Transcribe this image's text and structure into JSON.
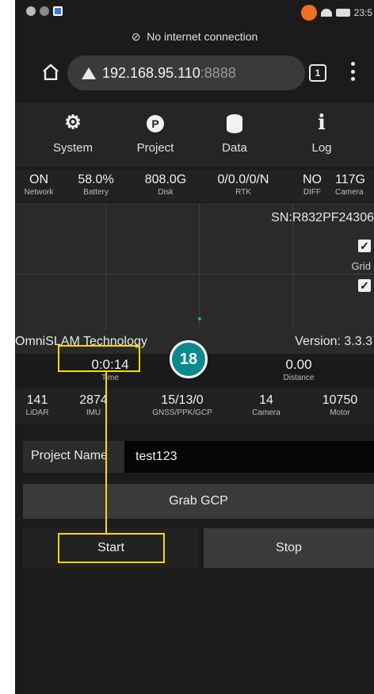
{
  "status_bar": {
    "time": "23:5"
  },
  "connection_banner": "No internet connection",
  "url_bar": {
    "host": "192.168.95.110",
    "port": ":8888",
    "tab_count": "1"
  },
  "nav": [
    {
      "label": "System",
      "icon": "gears-icon"
    },
    {
      "label": "Project",
      "icon": "project-icon",
      "glyph": "P"
    },
    {
      "label": "Data",
      "icon": "database-icon"
    },
    {
      "label": "Log",
      "icon": "info-icon",
      "glyph": "i"
    }
  ],
  "metrics_top": [
    {
      "value": "ON",
      "key": "Network"
    },
    {
      "value": "58.0%",
      "key": "Battery"
    },
    {
      "value": "808.0G",
      "key": "Disk"
    },
    {
      "value": "0/0.0/0/N",
      "key": "RTK"
    },
    {
      "value": "NO",
      "key": "DIFF"
    },
    {
      "value": "117G",
      "key": "Camera"
    }
  ],
  "map": {
    "serial": "SN:R832PF24306",
    "grid_label": "Grid"
  },
  "device": {
    "brand": "OmniSLAM Technology",
    "version": "Version: 3.3.3"
  },
  "progress": {
    "time_value": "0:0:14",
    "time_key": "Time",
    "distance_value": "0.00",
    "distance_key": "Distance"
  },
  "metrics_bottom": [
    {
      "value": "141",
      "key": "LiDAR"
    },
    {
      "value": "2874",
      "key": "IMU"
    },
    {
      "value": "15/13/0",
      "key": "GNSS/PPK/GCP"
    },
    {
      "value": "14",
      "key": "Camera"
    },
    {
      "value": "10750",
      "key": "Motor"
    }
  ],
  "form": {
    "project_name_label": "Project Name",
    "project_name_value": "test123",
    "grab_gcp_label": "Grab GCP",
    "start_label": "Start",
    "stop_label": "Stop"
  },
  "annotation": {
    "step_number": "18",
    "highlight_color": "#ffd800",
    "badge_color": "#0b8a8e"
  }
}
